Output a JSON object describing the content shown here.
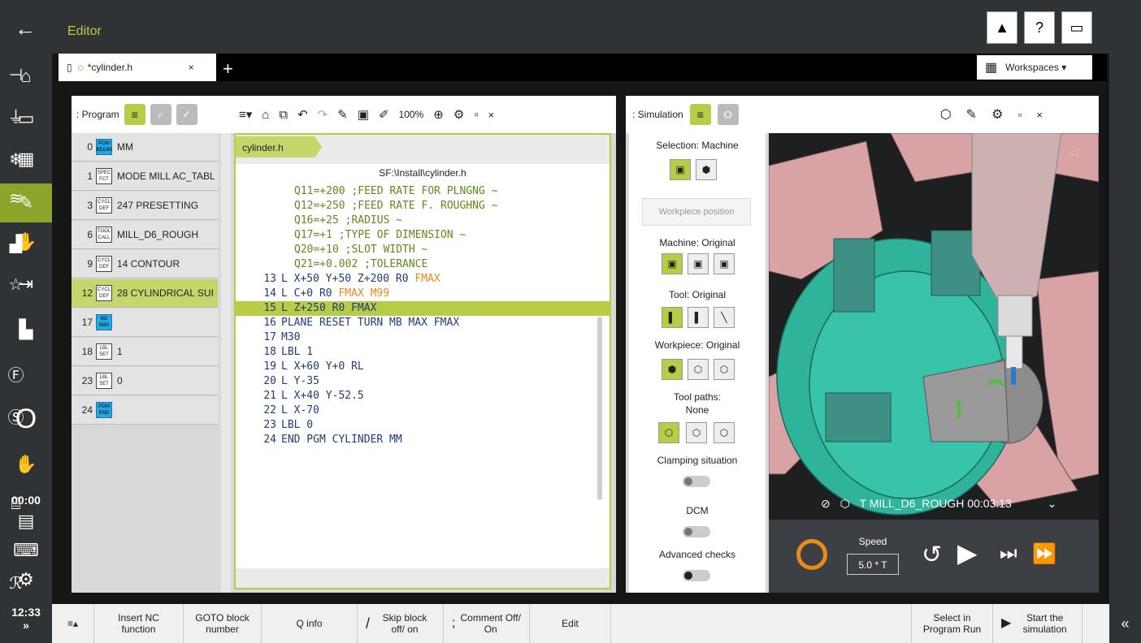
{
  "topbar": {
    "back_icon": "arrow-left-icon",
    "title": "Editor",
    "icons": [
      "warning-icon",
      "help-icon",
      "window-switch-icon"
    ]
  },
  "tab": {
    "label": "*cylinder.h",
    "close": "×",
    "add": "+"
  },
  "workspaces": {
    "label": "Workspaces ▾"
  },
  "leftrail": {
    "items": [
      "home-icon",
      "folder-icon",
      "table-icon",
      "editor-icon",
      "manual-hand-icon",
      "program-run-icon",
      "machine-icon"
    ],
    "status_circle": "O",
    "hand_icon": "hand-icon",
    "time_label": "00:00",
    "clock": "12:33",
    "expand": "»"
  },
  "program_panel": {
    "title": ": Program",
    "rows": [
      {
        "num": "0",
        "badge": [
          "PGM",
          "BEGIN"
        ],
        "text": "MM",
        "blue": true
      },
      {
        "num": "1",
        "badge": [
          "SPEC",
          "FCT"
        ],
        "text": "MODE MILL AC_TABL",
        "blue": false
      },
      {
        "num": "3",
        "badge": [
          "CYCL",
          "DEF"
        ],
        "text": "247 PRESETTING",
        "blue": false
      },
      {
        "num": "6",
        "badge": [
          "TOOL",
          "CALL"
        ],
        "text": "MILL_D6_ROUGH",
        "blue": false
      },
      {
        "num": "9",
        "badge": [
          "CYCL",
          "DEF"
        ],
        "text": "14 CONTOUR",
        "blue": false
      },
      {
        "num": "12",
        "badge": [
          "CYCL",
          "DEF"
        ],
        "text": "28 CYLINDRICAL SUI",
        "blue": false,
        "selected": true
      },
      {
        "num": "17",
        "badge": [
          "M2",
          "M30"
        ],
        "text": "",
        "blue": true
      },
      {
        "num": "18",
        "badge": [
          "LBL",
          "SET"
        ],
        "text": "1",
        "blue": false
      },
      {
        "num": "23",
        "badge": [
          "LBL",
          "SET"
        ],
        "text": "0",
        "blue": false
      },
      {
        "num": "24",
        "badge": [
          "PGM",
          "END"
        ],
        "text": "",
        "blue": true
      }
    ]
  },
  "editor": {
    "zoom": "100%",
    "breadcrumb": "cylinder.h",
    "filepath": "SF:\\Install\\cylinder.h",
    "lines": [
      {
        "n": "",
        "parts": [
          [
            "Q11=+200 ;FEED RATE FOR PLNGNG ~",
            "green"
          ]
        ]
      },
      {
        "n": "",
        "parts": [
          [
            "Q12=+250 ;FEED RATE F. ROUGHNG ~",
            "green"
          ]
        ]
      },
      {
        "n": "",
        "parts": [
          [
            "Q16=+25 ;RADIUS ~",
            "green"
          ]
        ]
      },
      {
        "n": "",
        "parts": [
          [
            "Q17=+1 ;TYPE OF DIMENSION ~",
            "green"
          ]
        ]
      },
      {
        "n": "",
        "parts": [
          [
            "Q20=+10 ;SLOT WIDTH ~",
            "green"
          ]
        ]
      },
      {
        "n": "",
        "parts": [
          [
            "Q21=+0.002 ;TOLERANCE",
            "green"
          ]
        ]
      },
      {
        "n": "13",
        "parts": [
          [
            "L X+50 Y+50 Z+200 R0 ",
            ""
          ],
          [
            "FMAX",
            "orange"
          ]
        ]
      },
      {
        "n": "14",
        "parts": [
          [
            "L C+0 R0 ",
            ""
          ],
          [
            "FMAX M99",
            "orange"
          ]
        ]
      },
      {
        "n": "15",
        "parts": [
          [
            "L Z+250 R0 FMAX",
            ""
          ]
        ],
        "hl": true
      },
      {
        "n": "16",
        "parts": [
          [
            "PLANE RESET TURN MB MAX FMAX",
            ""
          ]
        ]
      },
      {
        "n": "17",
        "parts": [
          [
            "M30",
            ""
          ]
        ]
      },
      {
        "n": "18",
        "parts": [
          [
            "LBL 1",
            ""
          ]
        ]
      },
      {
        "n": "19",
        "parts": [
          [
            "L X+60 Y+0 RL",
            ""
          ]
        ]
      },
      {
        "n": "20",
        "parts": [
          [
            "L Y-35",
            ""
          ]
        ]
      },
      {
        "n": "21",
        "parts": [
          [
            "L X+40 Y-52.5",
            ""
          ]
        ]
      },
      {
        "n": "22",
        "parts": [
          [
            "L X-70",
            ""
          ]
        ]
      },
      {
        "n": "23",
        "parts": [
          [
            "LBL 0",
            ""
          ]
        ]
      },
      {
        "n": "24",
        "parts": [
          [
            "END PGM CYLINDER MM",
            ""
          ]
        ]
      }
    ]
  },
  "simulation": {
    "title": ": Simulation",
    "selection": "Selection: Machine",
    "workpiece_position": "Workpiece position",
    "machine": "Machine: Original",
    "tool": "Tool: Original",
    "workpiece": "Workpiece: Original",
    "toolpaths": "Tool paths:",
    "toolpaths_value": "None",
    "clamping": "Clamping situation",
    "dcm": "DCM",
    "advanced": "Advanced checks",
    "status": "T MILL_D6_ROUGH  00:03:13",
    "speed_label": "Speed",
    "speed_value": "5.0 * T"
  },
  "bottombar": {
    "menu": "≡▴",
    "insert": "Insert NC function",
    "goto": "GOTO block number",
    "qinfo": "Q info",
    "skip": "Skip block off/ on",
    "comment": "Comment Off/ On",
    "edit": "Edit",
    "select": "Select in Program Run",
    "start": "Start the simulation",
    "collapse": "«"
  },
  "colors": {
    "accent": "#b8cc46",
    "dark": "#2f3336",
    "orange": "#e98a1d"
  }
}
